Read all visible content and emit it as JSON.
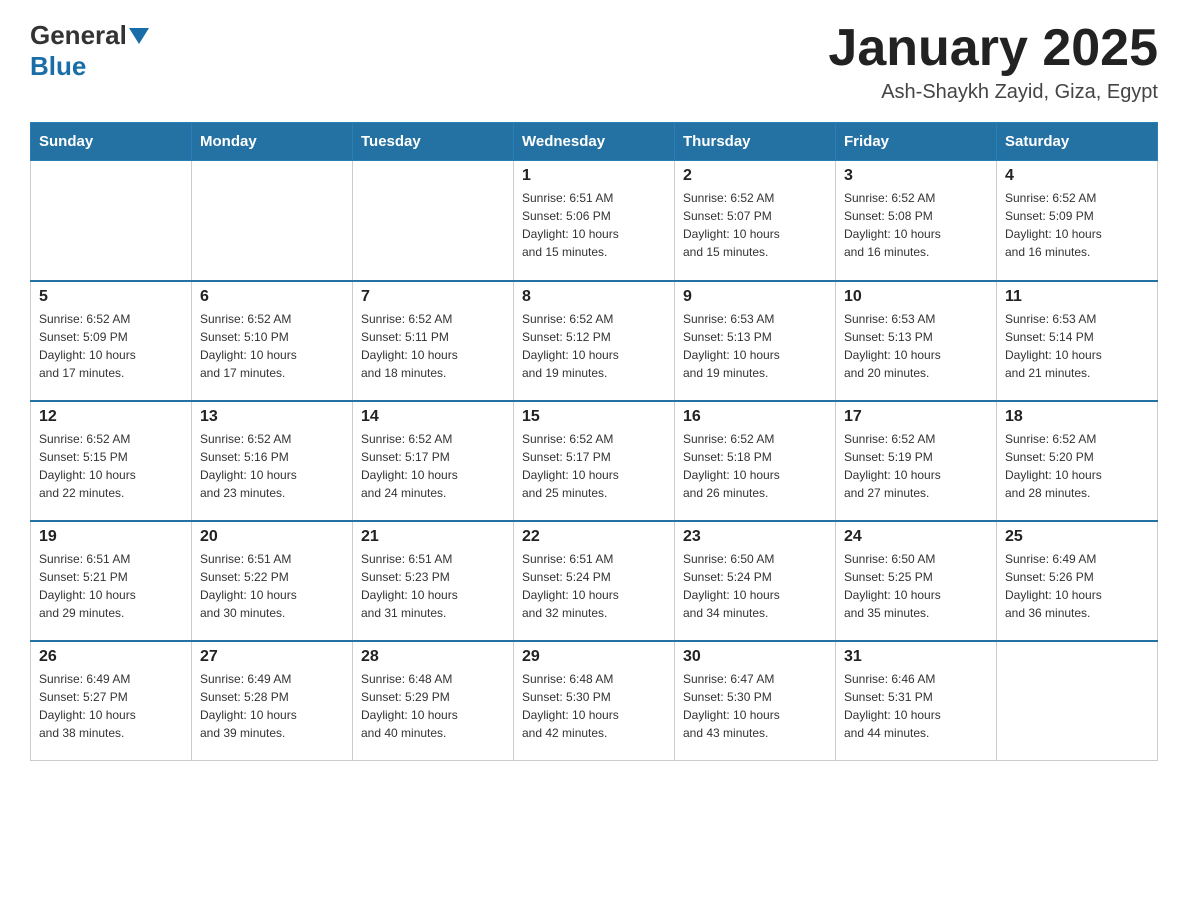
{
  "header": {
    "logo": {
      "general": "General",
      "blue": "Blue"
    },
    "title": "January 2025",
    "location": "Ash-Shaykh Zayid, Giza, Egypt"
  },
  "days_of_week": [
    "Sunday",
    "Monday",
    "Tuesday",
    "Wednesday",
    "Thursday",
    "Friday",
    "Saturday"
  ],
  "weeks": [
    [
      {
        "day": "",
        "info": ""
      },
      {
        "day": "",
        "info": ""
      },
      {
        "day": "",
        "info": ""
      },
      {
        "day": "1",
        "info": "Sunrise: 6:51 AM\nSunset: 5:06 PM\nDaylight: 10 hours\nand 15 minutes."
      },
      {
        "day": "2",
        "info": "Sunrise: 6:52 AM\nSunset: 5:07 PM\nDaylight: 10 hours\nand 15 minutes."
      },
      {
        "day": "3",
        "info": "Sunrise: 6:52 AM\nSunset: 5:08 PM\nDaylight: 10 hours\nand 16 minutes."
      },
      {
        "day": "4",
        "info": "Sunrise: 6:52 AM\nSunset: 5:09 PM\nDaylight: 10 hours\nand 16 minutes."
      }
    ],
    [
      {
        "day": "5",
        "info": "Sunrise: 6:52 AM\nSunset: 5:09 PM\nDaylight: 10 hours\nand 17 minutes."
      },
      {
        "day": "6",
        "info": "Sunrise: 6:52 AM\nSunset: 5:10 PM\nDaylight: 10 hours\nand 17 minutes."
      },
      {
        "day": "7",
        "info": "Sunrise: 6:52 AM\nSunset: 5:11 PM\nDaylight: 10 hours\nand 18 minutes."
      },
      {
        "day": "8",
        "info": "Sunrise: 6:52 AM\nSunset: 5:12 PM\nDaylight: 10 hours\nand 19 minutes."
      },
      {
        "day": "9",
        "info": "Sunrise: 6:53 AM\nSunset: 5:13 PM\nDaylight: 10 hours\nand 19 minutes."
      },
      {
        "day": "10",
        "info": "Sunrise: 6:53 AM\nSunset: 5:13 PM\nDaylight: 10 hours\nand 20 minutes."
      },
      {
        "day": "11",
        "info": "Sunrise: 6:53 AM\nSunset: 5:14 PM\nDaylight: 10 hours\nand 21 minutes."
      }
    ],
    [
      {
        "day": "12",
        "info": "Sunrise: 6:52 AM\nSunset: 5:15 PM\nDaylight: 10 hours\nand 22 minutes."
      },
      {
        "day": "13",
        "info": "Sunrise: 6:52 AM\nSunset: 5:16 PM\nDaylight: 10 hours\nand 23 minutes."
      },
      {
        "day": "14",
        "info": "Sunrise: 6:52 AM\nSunset: 5:17 PM\nDaylight: 10 hours\nand 24 minutes."
      },
      {
        "day": "15",
        "info": "Sunrise: 6:52 AM\nSunset: 5:17 PM\nDaylight: 10 hours\nand 25 minutes."
      },
      {
        "day": "16",
        "info": "Sunrise: 6:52 AM\nSunset: 5:18 PM\nDaylight: 10 hours\nand 26 minutes."
      },
      {
        "day": "17",
        "info": "Sunrise: 6:52 AM\nSunset: 5:19 PM\nDaylight: 10 hours\nand 27 minutes."
      },
      {
        "day": "18",
        "info": "Sunrise: 6:52 AM\nSunset: 5:20 PM\nDaylight: 10 hours\nand 28 minutes."
      }
    ],
    [
      {
        "day": "19",
        "info": "Sunrise: 6:51 AM\nSunset: 5:21 PM\nDaylight: 10 hours\nand 29 minutes."
      },
      {
        "day": "20",
        "info": "Sunrise: 6:51 AM\nSunset: 5:22 PM\nDaylight: 10 hours\nand 30 minutes."
      },
      {
        "day": "21",
        "info": "Sunrise: 6:51 AM\nSunset: 5:23 PM\nDaylight: 10 hours\nand 31 minutes."
      },
      {
        "day": "22",
        "info": "Sunrise: 6:51 AM\nSunset: 5:24 PM\nDaylight: 10 hours\nand 32 minutes."
      },
      {
        "day": "23",
        "info": "Sunrise: 6:50 AM\nSunset: 5:24 PM\nDaylight: 10 hours\nand 34 minutes."
      },
      {
        "day": "24",
        "info": "Sunrise: 6:50 AM\nSunset: 5:25 PM\nDaylight: 10 hours\nand 35 minutes."
      },
      {
        "day": "25",
        "info": "Sunrise: 6:49 AM\nSunset: 5:26 PM\nDaylight: 10 hours\nand 36 minutes."
      }
    ],
    [
      {
        "day": "26",
        "info": "Sunrise: 6:49 AM\nSunset: 5:27 PM\nDaylight: 10 hours\nand 38 minutes."
      },
      {
        "day": "27",
        "info": "Sunrise: 6:49 AM\nSunset: 5:28 PM\nDaylight: 10 hours\nand 39 minutes."
      },
      {
        "day": "28",
        "info": "Sunrise: 6:48 AM\nSunset: 5:29 PM\nDaylight: 10 hours\nand 40 minutes."
      },
      {
        "day": "29",
        "info": "Sunrise: 6:48 AM\nSunset: 5:30 PM\nDaylight: 10 hours\nand 42 minutes."
      },
      {
        "day": "30",
        "info": "Sunrise: 6:47 AM\nSunset: 5:30 PM\nDaylight: 10 hours\nand 43 minutes."
      },
      {
        "day": "31",
        "info": "Sunrise: 6:46 AM\nSunset: 5:31 PM\nDaylight: 10 hours\nand 44 minutes."
      },
      {
        "day": "",
        "info": ""
      }
    ]
  ]
}
